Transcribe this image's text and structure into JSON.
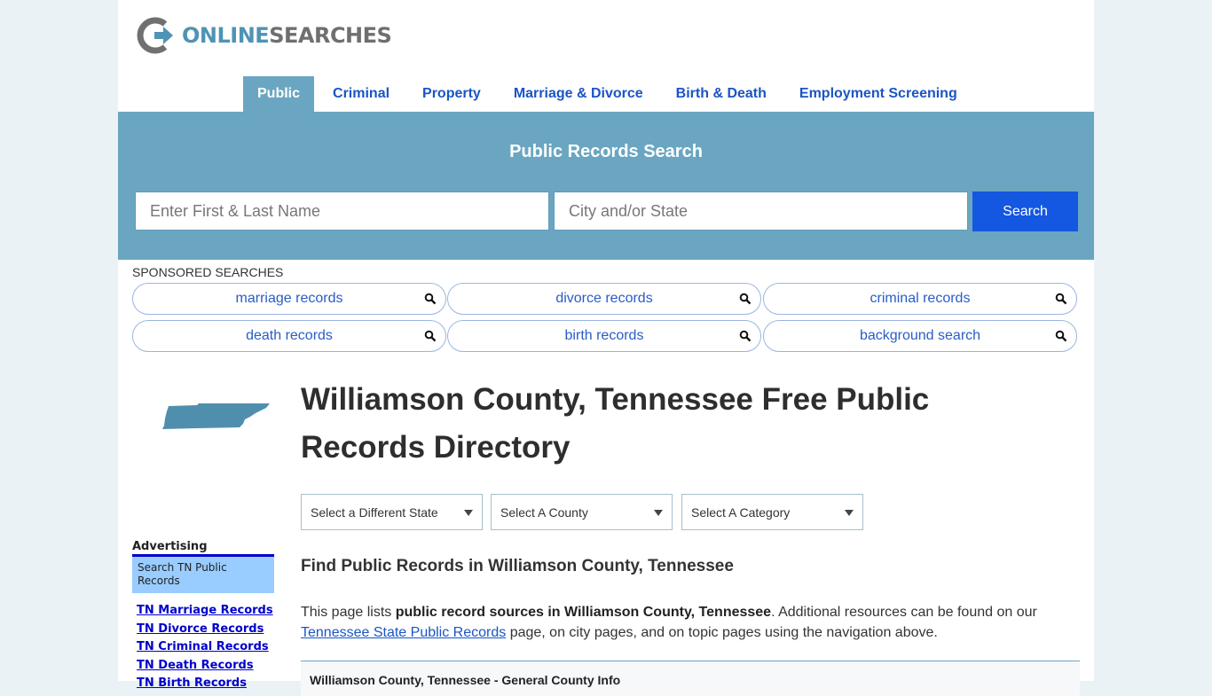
{
  "brand": {
    "logo_online": "ONLINE",
    "logo_searches": "SEARCHES",
    "accent": "#6aa6c1",
    "link": "#1a55c4",
    "button": "#1457e0"
  },
  "nav": {
    "items": [
      {
        "label": "Public",
        "active": true
      },
      {
        "label": "Criminal"
      },
      {
        "label": "Property"
      },
      {
        "label": "Marriage & Divorce"
      },
      {
        "label": "Birth & Death"
      },
      {
        "label": "Employment Screening"
      }
    ]
  },
  "search": {
    "title": "Public Records Search",
    "name_placeholder": "Enter First & Last Name",
    "city_placeholder": "City and/or State",
    "button_label": "Search"
  },
  "sponsored": {
    "label": "SPONSORED SEARCHES",
    "items": [
      {
        "label": "marriage records",
        "icon": "search-icon"
      },
      {
        "label": "divorce records",
        "icon": "search-icon"
      },
      {
        "label": "criminal records",
        "icon": "search-icon"
      },
      {
        "label": "death records",
        "icon": "search-icon"
      },
      {
        "label": "birth records",
        "icon": "search-icon"
      },
      {
        "label": "background search",
        "icon": "search-icon"
      }
    ]
  },
  "main": {
    "title": "Williamson County, Tennessee Free Public Records Directory",
    "selects": [
      {
        "value": "Select a Different State"
      },
      {
        "value": "Select A County"
      },
      {
        "value": "Select A Category"
      }
    ],
    "section_title": "Find Public Records in Williamson County, Tennessee",
    "intro_pre": "This page lists ",
    "intro_bold": "public record sources in Williamson County, Tennessee",
    "intro_mid": ". Additional resources can be found on our ",
    "intro_link": "Tennessee State Public Records",
    "intro_post": " page, on city pages, and on topic pages using the navigation above.",
    "info_box_title": "Williamson County, Tennessee - General County Info"
  },
  "sidebar": {
    "ad_label": "Advertising",
    "ad_box": "Search TN Public Records",
    "links": [
      "TN Marriage Records",
      "TN Divorce Records",
      "TN Criminal Records",
      "TN Death Records",
      "TN Birth Records"
    ]
  }
}
